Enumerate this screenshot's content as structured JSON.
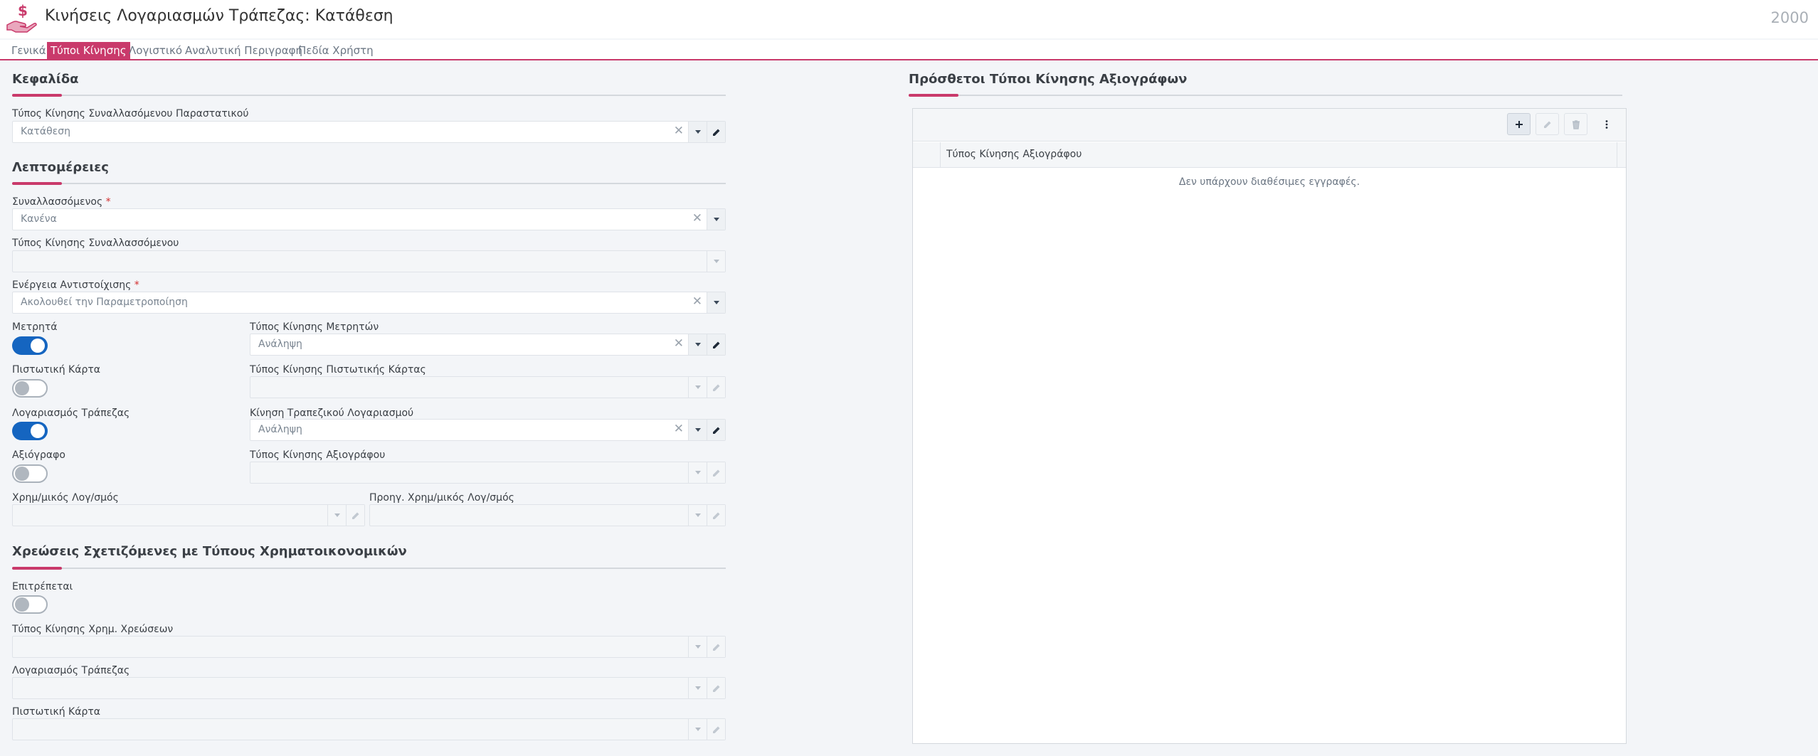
{
  "header": {
    "title": "Κινήσεις Λογαριασμών Τράπεζας: Κατάθεση",
    "record_id": "2000",
    "icon": "money-hand-icon"
  },
  "tabs": [
    {
      "label": "Γενικά",
      "active": false
    },
    {
      "label": "Τύποι Κίνησης",
      "active": true
    },
    {
      "label": "Λογιστικό",
      "active": false
    },
    {
      "label": "Αναλυτική Περιγραφή",
      "active": false
    },
    {
      "label": "Πεδία Χρήστη",
      "active": false
    }
  ],
  "header_section": {
    "title": "Κεφαλίδα",
    "doc_movement_type": {
      "label": "Τύπος Κίνησης Συναλλασόμενου Παραστατικού",
      "value": "Κατάθεση"
    }
  },
  "details": {
    "title": "Λεπτομέρειες",
    "trader": {
      "label": "Συναλλασσόμενος",
      "value": "Κανένα",
      "required": "*"
    },
    "trader_movement_type": {
      "label": "Τύπος Κίνησης Συναλλασσόμενου",
      "value": ""
    },
    "matching_action": {
      "label": "Ενέργεια Αντιστοίχισης",
      "value": "Ακολουθεί την Παραμετροποίηση",
      "required": "*"
    },
    "cash": {
      "label": "Μετρητά",
      "on": true
    },
    "cash_movement_type": {
      "label": "Τύπος Κίνησης Μετρητών",
      "value": "Ανάληψη"
    },
    "credit_card": {
      "label": "Πιστωτική Κάρτα",
      "on": false
    },
    "credit_card_movement_type": {
      "label": "Τύπος Κίνησης Πιστωτικής Κάρτας",
      "value": ""
    },
    "bank_account": {
      "label": "Λογαριασμός Τράπεζας",
      "on": true
    },
    "bank_account_movement": {
      "label": "Κίνηση Τραπεζικού Λογαριασμού",
      "value": "Ανάληψη"
    },
    "cheque": {
      "label": "Αξιόγραφο",
      "on": false
    },
    "cheque_movement_type": {
      "label": "Τύπος Κίνησης Αξιογράφου",
      "value": ""
    },
    "fin_account": {
      "label": "Χρημ/μικός Λογ/σμός",
      "value": ""
    },
    "prev_fin_account": {
      "label": "Προηγ. Χρημ/μικός Λογ/σμός",
      "value": ""
    }
  },
  "charges": {
    "title": "Χρεώσεις Σχετιζόμενες με Τύπους Χρηματοικονομικών",
    "allowed": {
      "label": "Επιτρέπεται",
      "on": false
    },
    "charges_movement_type": {
      "label": "Τύπος Κίνησης Χρημ. Χρεώσεων",
      "value": ""
    },
    "bank_account": {
      "label": "Λογαριασμός Τράπεζας",
      "value": ""
    },
    "credit_card": {
      "label": "Πιστωτική Κάρτα",
      "value": ""
    }
  },
  "cheque_types": {
    "title": "Πρόσθετοι Τύποι Κίνησης Αξιογράφων",
    "column": "Τύπος Κίνησης Αξιογράφου",
    "empty": "Δεν υπάρχουν διαθέσιμες εγγραφές.",
    "toolbar_icons": [
      "plus-icon",
      "edit-icon",
      "trash-icon",
      "more-vertical-icon"
    ]
  },
  "colors": {
    "accent": "#c93a6b",
    "toggle_on": "#1565c0",
    "background": "#f3f5f8"
  }
}
